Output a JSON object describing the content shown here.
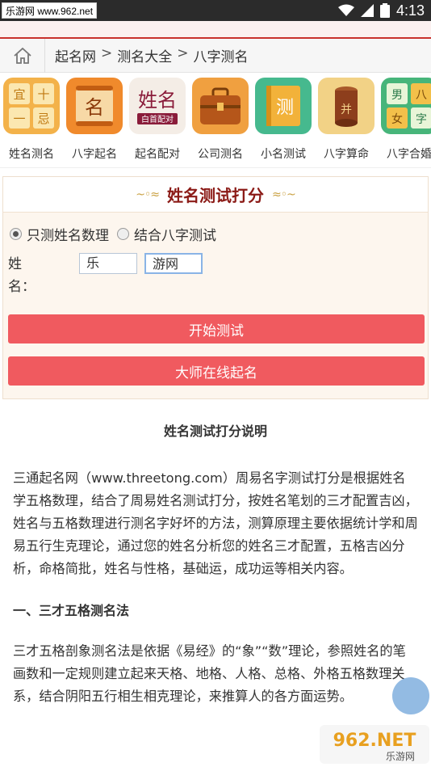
{
  "status": {
    "watermark": "乐游网 www.962.net",
    "time": "4:13"
  },
  "breadcrumb": {
    "items": [
      "起名网",
      "测名大全",
      "八字测名"
    ],
    "separator": ">"
  },
  "icons": [
    {
      "label": "姓名测名",
      "icon": "grid-icon",
      "glyphs": [
        "宜",
        "十",
        "一",
        "忌"
      ]
    },
    {
      "label": "八字起名",
      "icon": "scroll-icon",
      "glyph": "名"
    },
    {
      "label": "起名配对",
      "icon": "couple-icon",
      "glyph": "姓名",
      "sub": "白首配对"
    },
    {
      "label": "公司测名",
      "icon": "briefcase-icon"
    },
    {
      "label": "小名测试",
      "icon": "book-icon",
      "glyph": "测"
    },
    {
      "label": "八字算命",
      "icon": "drum-icon",
      "glyph": "并"
    },
    {
      "label": "八字合婚",
      "icon": "match-icon",
      "glyphs": [
        "男",
        "八",
        "女",
        "字"
      ]
    }
  ],
  "form": {
    "title": "姓名测试打分",
    "radio_options": [
      "只测姓名数理",
      "结合八字测试"
    ],
    "selected_option": "只测姓名数理",
    "name_label": "姓名：",
    "surname_value": "乐",
    "given_value": "游网",
    "test_button": "开始测试",
    "master_button": "大师在线起名"
  },
  "article": {
    "title": "姓名测试打分说明",
    "para1": "三通起名网（www.threetong.com）周易名字测试打分是根据姓名学五格数理，结合了周易姓名测试打分，按姓名笔划的三才配置吉凶，姓名与五格数理进行测名字好坏的方法，测算原理主要依据统计学和周易五行生克理论，通过您的姓名分析您的姓名三才配置，五格吉凶分析，命格简批，姓名与性格，基础运，成功运等相关内容。",
    "heading1": "一、三才五格测名法",
    "para2": "三才五格剖象测名法是依据《易经》的“象”“数”理论，参照姓名的笔画数和一定规则建立起来天格、地格、人格、总格、外格五格数理关系，结合阴阳五行相生相克理论，来推算人的各方面运势。"
  },
  "watermark_logo": {
    "text": "962.NET",
    "sub": "乐游网"
  },
  "colors": {
    "accent": "#f05a5f",
    "title": "#8b1a16",
    "panel": "#fdf6ee"
  }
}
